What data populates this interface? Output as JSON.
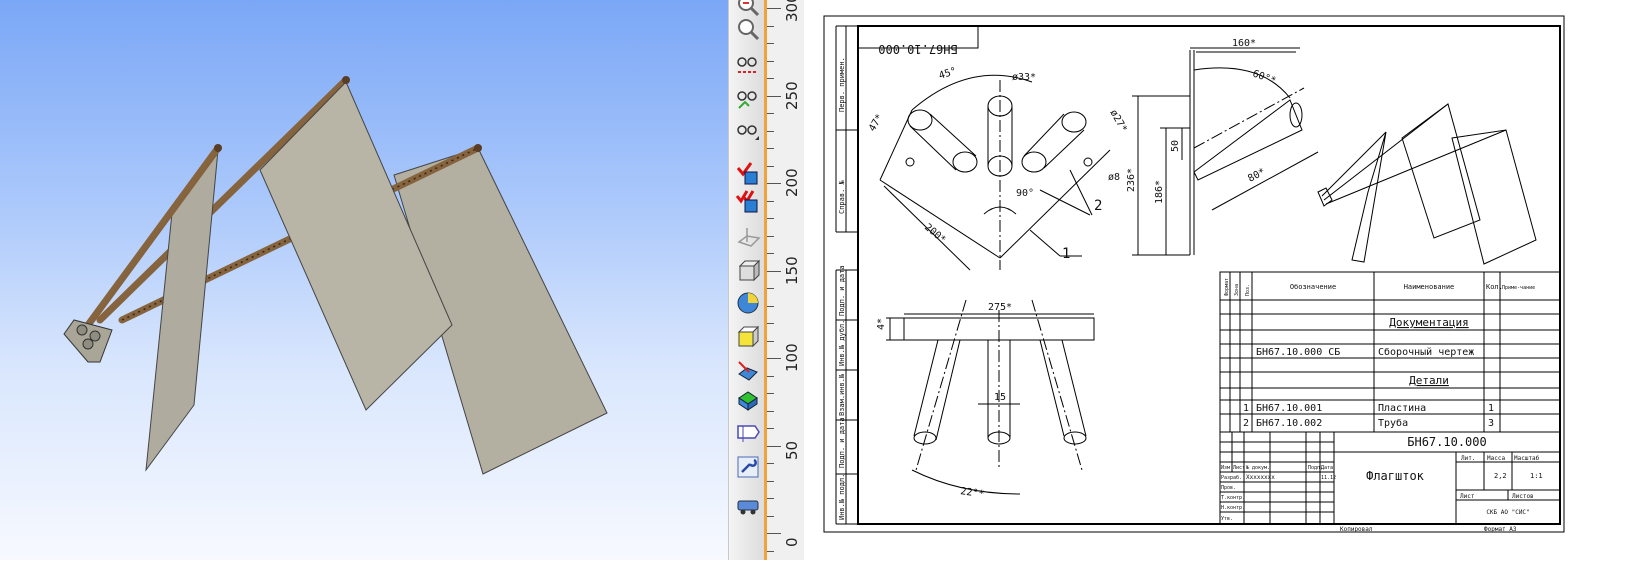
{
  "ruler": {
    "labels": [
      "300",
      "250",
      "200",
      "150",
      "100",
      "50",
      "0"
    ]
  },
  "toolbar": {
    "tools": [
      "zoom-in-icon",
      "zoom-scale-icon",
      "hide-icon",
      "show-icon",
      "glasses-icon",
      "check-box-icon",
      "check-boxes-icon",
      "plane-icon",
      "box-icon",
      "sphere-icon",
      "cube-icon",
      "edge-icon",
      "face-icon",
      "section-icon",
      "wrench-icon",
      "car-icon"
    ]
  },
  "drawing": {
    "designation_stamp": "БН67.10.000",
    "dims": {
      "angle45": "45°",
      "dia33": "ø33*",
      "d47": "47*",
      "dia27": "ø27*",
      "dia8": "ø8",
      "angle90": "90°",
      "d200": "200*",
      "len160": "160*",
      "angle60": "60°*",
      "d50": "50",
      "d236": "236*",
      "d186": "186*",
      "d80": "80*",
      "d275": "275*",
      "d4": "4*",
      "d15": "15",
      "angle22": "22°*",
      "callout1": "1",
      "callout2": "2"
    },
    "side_labels": [
      "Перв. примен.",
      "Справ. №",
      "Подп. и дата",
      "Инв.№ дубл.",
      "Взам.инв.№",
      "Подп. и дата",
      "Инв.№ подл."
    ],
    "spec": {
      "headers": {
        "format": "Формат",
        "zone": "Зона",
        "pos": "Поз.",
        "designation": "Обозначение",
        "name": "Наименование",
        "qty": "Кол.",
        "note": "Приме-чание"
      },
      "section_docs": "Документация",
      "doc_designation": "БН67.10.000 СБ",
      "doc_name": "Сборочный чертеж",
      "section_parts": "Детали",
      "rows": [
        {
          "pos": "1",
          "designation": "БН67.10.001",
          "name": "Пластина",
          "qty": "1"
        },
        {
          "pos": "2",
          "designation": "БН67.10.002",
          "name": "Труба",
          "qty": "3"
        }
      ]
    },
    "title_block": {
      "designation": "БН67.10.000",
      "name": "Флагшток",
      "lit": "Лит.",
      "mass_label": "Масса",
      "scale_label": "Масштаб",
      "mass": "2,2",
      "scale": "1:1",
      "sheet_label": "Лист",
      "sheets_label": "Листов",
      "org": "СКБ АО \"СИС\"",
      "rows": [
        "Изм",
        "Разраб.",
        "Пров.",
        "Т.контр.",
        "Н.контр.",
        "Утв."
      ],
      "col_labels": [
        "Изм",
        "Лист",
        "№ докум.",
        "Подп.",
        "Дата"
      ],
      "developer": "Xxxxxxxx",
      "date": "11.12",
      "copied": "Копировал",
      "format": "Формат  А3"
    }
  }
}
